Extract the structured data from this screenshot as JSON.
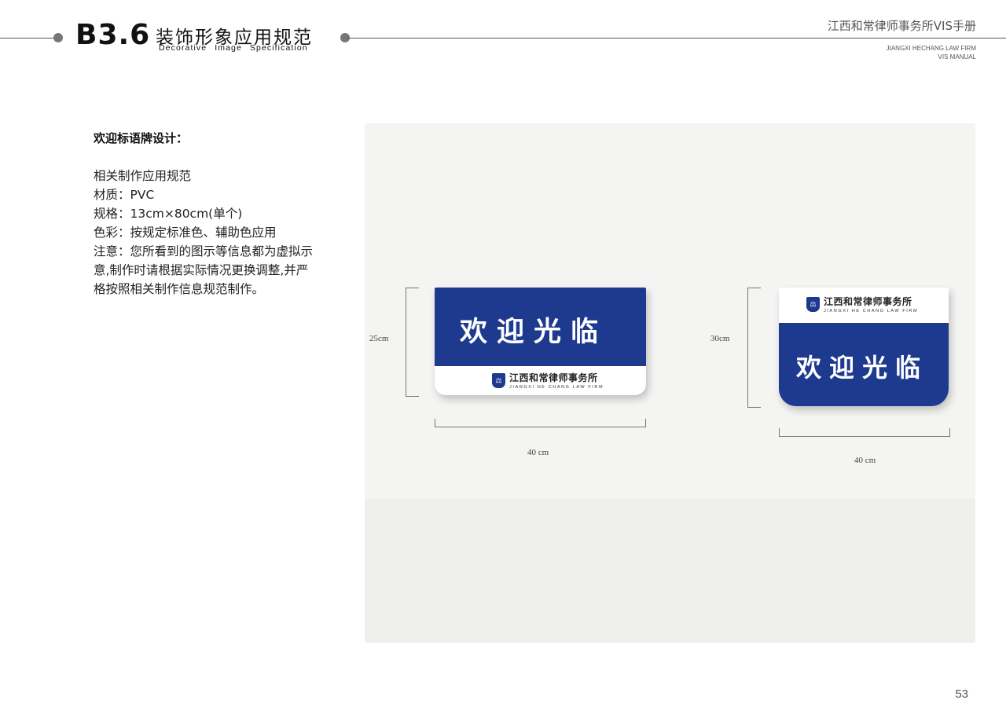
{
  "header": {
    "section_no": "B3.6",
    "section_title": "装饰形象应用规范",
    "section_subtitle": "Decorative Image   Specification",
    "manual_title": "江西和常律师事务所VIS手册",
    "manual_en_line1": "JIANGXI HECHANG LAW FIRM",
    "manual_en_line2": "VIS MANUAL"
  },
  "content": {
    "lead": "欢迎标语牌设计：",
    "spec_lines": [
      "相关制作应用规范",
      "材质：PVC",
      "规格：13cm×80cm(单个)",
      "色彩：按规定标准色、辅助色应用",
      "注意：您所看到的图示等信息都为虚拟示",
      "意,制作时请根据实际情况更换调整,并严",
      "格按照相关制作信息规范制作。"
    ]
  },
  "signs": [
    {
      "welcome": "欢迎光临",
      "brand_cn": "江西和常律师事务所",
      "brand_en": "JIANGXI HE CHANG LAW FIRM",
      "height_label": "25cm",
      "width_label": "40 cm"
    },
    {
      "welcome": "欢迎光临",
      "brand_cn": "江西和常律师事务所",
      "brand_en": "JIANGXI HE CHANG LAW FIRM",
      "height_label": "30cm",
      "width_label": "40 cm"
    }
  ],
  "colors": {
    "brand_blue": "#1d3a8f",
    "panel_bg": "#f4f4f3"
  },
  "logo_icon": "shield-logo-icon",
  "page_number": "53"
}
